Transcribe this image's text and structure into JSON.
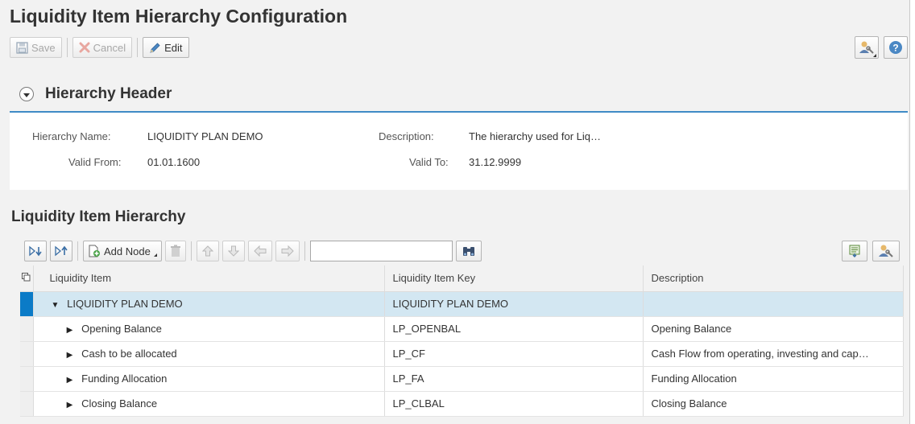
{
  "page": {
    "title": "Liquidity Item Hierarchy Configuration"
  },
  "toolbar": {
    "save_label": "Save",
    "cancel_label": "Cancel",
    "edit_label": "Edit"
  },
  "header_section": {
    "title": "Hierarchy Header",
    "hierarchy_name_label": "Hierarchy Name:",
    "hierarchy_name": "LIQUIDITY PLAN DEMO",
    "description_label": "Description:",
    "description": "The hierarchy used for Liq…",
    "valid_from_label": "Valid From:",
    "valid_from": "01.01.1600",
    "valid_to_label": "Valid To:",
    "valid_to": "31.12.9999"
  },
  "hierarchy_section": {
    "title": "Liquidity Item Hierarchy",
    "add_node_label": "Add Node",
    "search_value": "",
    "columns": [
      "Liquidity Item",
      "Liquidity Item Key",
      "Description"
    ],
    "rows": [
      {
        "item": "LIQUIDITY PLAN DEMO",
        "key": "LIQUIDITY PLAN DEMO",
        "description": "",
        "expanded": true,
        "level": 0
      },
      {
        "item": "Opening Balance",
        "key": "LP_OPENBAL",
        "description": "Opening Balance",
        "expanded": false,
        "level": 1
      },
      {
        "item": "Cash to be allocated",
        "key": "LP_CF",
        "description": "Cash Flow from operating, investing and cap…",
        "expanded": false,
        "level": 1
      },
      {
        "item": "Funding Allocation",
        "key": "LP_FA",
        "description": "Funding Allocation",
        "expanded": false,
        "level": 1
      },
      {
        "item": "Closing Balance",
        "key": "LP_CLBAL",
        "description": "Closing Balance",
        "expanded": false,
        "level": 1
      }
    ]
  },
  "colors": {
    "accent": "#3f8bc6",
    "selected_row": "#d3e7f2",
    "selected_marker": "#0b7bc7"
  }
}
